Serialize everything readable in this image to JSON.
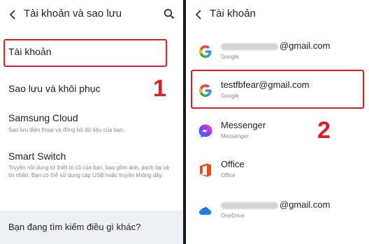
{
  "left": {
    "header_title": "Tài khoản và sao lưu",
    "items": [
      {
        "title": "Tài khoản"
      },
      {
        "title": "Sao lưu và khôi phục"
      },
      {
        "title": "Samsung Cloud",
        "subtitle": "Sao lưu điện thoại và đồng bộ dữ liệu của bạn."
      },
      {
        "title": "Smart Switch",
        "subtitle": "Truyền nội dung từ thiết bị cũ của bạn, bao gồm ảnh, danh bạ và tin nhắn. Bạn có thể sử dụng cáp USB hoặc truyền không dây."
      }
    ],
    "suggest": "Bạn đang tìm kiếm điều gì khác?",
    "step": "1"
  },
  "right": {
    "header_title": "Tài khoản",
    "accounts": [
      {
        "name": "@gmail.com",
        "type": "Google",
        "icon": "google-icon"
      },
      {
        "name": "testfbfear@gmail.com",
        "type": "Google",
        "icon": "google-icon"
      },
      {
        "name": "Messenger",
        "type": "Messenger",
        "icon": "messenger-icon"
      },
      {
        "name": "Office",
        "type": "Office",
        "icon": "office-icon"
      },
      {
        "name": "@gmail.com",
        "type": "OneDrive",
        "icon": "onedrive-icon"
      }
    ],
    "step": "2"
  },
  "colors": {
    "highlight": "#d8202a",
    "background": "#ffffff",
    "divider": "#1a1a1a"
  }
}
